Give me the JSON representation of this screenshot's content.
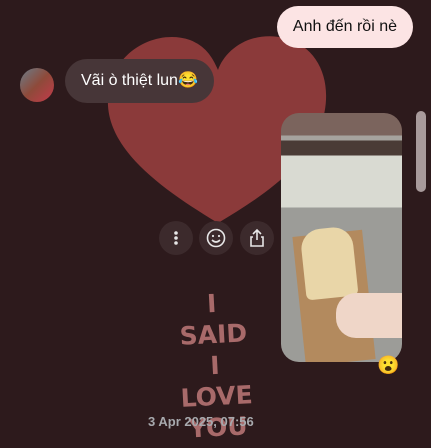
{
  "messages": [
    {
      "direction": "outgoing",
      "text": "Anh đến rồi nè"
    },
    {
      "direction": "incoming",
      "text": "Vãi ò thiệt lun😂"
    }
  ],
  "photo_message": {
    "reaction": "😮"
  },
  "actions": {
    "more_icon": "more-vertical-icon",
    "react_icon": "smiley-icon",
    "share_icon": "share-icon"
  },
  "background": {
    "doodle_text": "I SAID I LOVE YOU",
    "color": "#2d1a1c",
    "heart_color": "#8b3a3a"
  },
  "timestamp": "3 Apr 2025, 07:56"
}
